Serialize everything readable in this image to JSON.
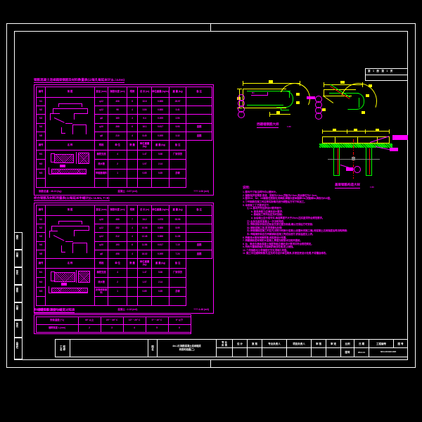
{
  "sheet": {
    "background": "#000000",
    "frame_color": "#ffffff",
    "accent_magenta": "#ff00ff",
    "accent_green": "#00ff00",
    "accent_yellow": "#ffff00",
    "accent_red": "#ff0000",
    "accent_gray": "#808080"
  },
  "header_box": {
    "text": "第 1 册 第 1 页"
  },
  "table1": {
    "title": "钢筋混凝土连续箱梁钢筋及材料数量表(以每孔每延米计)(L=4.0m)",
    "columns": [
      "编号",
      "简  图",
      "直径 (mm)",
      "钢筋长度 (cm)",
      "根数",
      "总  长 (m)",
      "单位重量 (kg/m)",
      "重  量 (kg)",
      "备  注"
    ],
    "rows": [
      {
        "no": "N1",
        "dia": "φ12",
        "len": "408",
        "cnt": "8",
        "total": "32.6",
        "unit": "0.888",
        "weight": "28.97",
        "note": ""
      },
      {
        "no": "N2",
        "dia": "φ12",
        "len": "96",
        "cnt": "4",
        "total": "3.84",
        "unit": "0.888",
        "weight": "3.41",
        "note": ""
      },
      {
        "no": "N3",
        "dia": "φ8",
        "len": "160",
        "cnt": "4",
        "total": "6.4",
        "unit": "0.395",
        "weight": "2.53",
        "note": ""
      },
      {
        "no": "N4",
        "dia": "φ10",
        "len": "268",
        "cnt": "6",
        "total": "16.1",
        "unit": "0.617",
        "weight": "9.93",
        "note": "盘圆"
      },
      {
        "no": "N5",
        "dia": "φ8",
        "len": "210",
        "cnt": "4",
        "total": "8.40",
        "unit": "0.395",
        "weight": "3.32",
        "note": "盘圆"
      }
    ],
    "sub_header": [
      "编号",
      "名  称",
      "规格",
      "单  位",
      "数  量",
      "单位重量 (kg)",
      "重  量 (kg)",
      "备  注"
    ],
    "rows2": [
      {
        "no": "M1",
        "name": "橡胶支座",
        "spec": "",
        "unit": "4",
        "qty": "",
        "each": "1.47",
        "weight": "5.88",
        "note": "厂家供货"
      },
      {
        "no": "M2",
        "name": "泄水管",
        "spec": "",
        "unit": "2",
        "qty": "",
        "each": "1.07",
        "weight": "2.14",
        "note": ""
      },
      {
        "no": "M3",
        "name": "伸缩缝填料",
        "spec": "",
        "unit": "1",
        "qty": "",
        "each": "0.85",
        "weight": "0.85",
        "note": "沥青"
      }
    ],
    "footer": {
      "left": "钢筋总重 : 48.16  (kg)",
      "mid": "混凝土 : 0.57  (m3)",
      "right": "??? 1.68  (m3)"
    }
  },
  "table2": {
    "title": "桥台钢筋及材料用量表(以每延米半幅计)(L=4.0m, T=8)",
    "columns": [
      "编号",
      "简  图",
      "直径 (mm)",
      "钢筋长度 (cm)",
      "根数",
      "总  长 (m)",
      "单位重量 (kg/m)",
      "重  量 (kg)",
      "备  注"
    ],
    "rows": [
      {
        "no": "N1",
        "dia": "φ16",
        "len": "488",
        "cnt": "7",
        "total": "34.2",
        "unit": "1.578",
        "weight": "53.96",
        "note": ""
      },
      {
        "no": "N2",
        "dia": "φ12",
        "len": "252",
        "cnt": "4",
        "total": "10.08",
        "unit": "0.888",
        "weight": "8.95",
        "note": ""
      },
      {
        "no": "N3",
        "dia": "φ12",
        "len": "312",
        "cnt": "4",
        "total": "12.48",
        "unit": "0.888",
        "weight": "11.08",
        "note": ""
      },
      {
        "no": "N4",
        "dia": "φ10",
        "len": "193",
        "cnt": "6",
        "total": "11.58",
        "unit": "0.617",
        "weight": "7.15",
        "note": "盘圆"
      },
      {
        "no": "N5",
        "dia": "φ8",
        "len": "458",
        "cnt": "4",
        "total": "18.32",
        "unit": "0.395",
        "weight": "7.24",
        "note": "盘圆"
      }
    ],
    "sub_header": [
      "编号",
      "名  称",
      "规格",
      "单  位",
      "数  量",
      "单位重量 (kg)",
      "重  量 (kg)",
      "备  注"
    ],
    "rows2": [
      {
        "no": "M1",
        "name": "橡胶支座",
        "spec": "",
        "unit": "4",
        "qty": "",
        "each": "1.47",
        "weight": "5.88",
        "note": "厂家供货"
      },
      {
        "no": "M2",
        "name": "泄水管",
        "spec": "",
        "unit": "2",
        "qty": "",
        "each": "1.07",
        "weight": "2.14",
        "note": ""
      },
      {
        "no": "M3",
        "name": "沥青麻絮填料",
        "spec": "",
        "unit": "1",
        "qty": "",
        "each": "0.85",
        "weight": "0.85",
        "note": "沥青"
      }
    ],
    "footer": {
      "left": "钢筋总重 : 88.38  (kg)",
      "mid": "混凝土 : 2.18  (m3)",
      "right": "??? 4.48  (m3)"
    }
  },
  "table3": {
    "title": "伸缩缝安装温度与缝宽对照表",
    "header": [
      "安装温度 (°C)",
      "30° 以上",
      "20° ~ 30° C",
      "10° ~ 20° C",
      "0° ~ 10° C",
      "0° 以下"
    ],
    "row": [
      "缝隙宽度 L (mm)",
      "2",
      "3",
      "4",
      "5",
      "6"
    ]
  },
  "detail1": {
    "label": "挡碴墙钢筋大样",
    "scale": "1:20"
  },
  "detail2": {
    "label": "",
    "scale": ""
  },
  "detail3": {
    "label": "盖梁钢筋构造大样",
    "scale": "1:20"
  },
  "notes": {
    "title": "说明:",
    "items": [
      {
        "indent": 0,
        "text": "1. 图中尺寸除注明外均以厘米计。"
      },
      {
        "indent": 0,
        "text": "2. 钢筋保护层厚度:梁底、梁侧为3.0cm,顶板为2.5cm,其余部位为2~3cm。"
      },
      {
        "indent": 0,
        "text": "3. 图中N1、N2、N3钢筋在搭接处须焊接,焊缝长度单面焊10d,双面焊5d,焊条为E43型。"
      },
      {
        "indent": 0,
        "text": "4. ①号钢筋在施工时应按实际情况进行调整后方可下料加工。"
      },
      {
        "indent": 0,
        "text": "5. 本桥施工工艺要求如下:"
      },
      {
        "indent": 1,
        "text": "⑴. a. 基坑开挖应按设计要求进行;"
      },
      {
        "indent": 2,
        "text": "b. 基底承载力应满足设计要求;"
      },
      {
        "indent": 2,
        "text": "c. 基础施工完毕后应及时回填;"
      },
      {
        "indent": 2,
        "text": "d. 台后填土应分层夯实,每层厚度不大于20cm,压实度须符合规范要求。"
      },
      {
        "indent": 1,
        "text": "⑵. 台身及盖梁混凝土一次浇筑完成;"
      },
      {
        "indent": 1,
        "text": "⑶. 预制梁板安装前应检查支座位置及标高,确认无误后方可安装;"
      },
      {
        "indent": 1,
        "text": "⑷. 铺装层施工前,梁顶须凿毛处理;"
      },
      {
        "indent": 1,
        "text": "⑸. 桥面铺装层施工时应先浇筑中间部分混凝土(设置纵向施工缝),待混凝土达到强度后再浇筑两侧;"
      },
      {
        "indent": 1,
        "text": "⑹. 伸缩缝安装应在桥面铺装层施工完成后进行,安装温度见上表。"
      },
      {
        "indent": 0,
        "text": "6. 桥面泄水管采用铸铁管,间距按设计布置。"
      },
      {
        "indent": 0,
        "text": "7. 桥面铺装层采用防水混凝土,厚度及配筋详见相关图纸。"
      },
      {
        "indent": 0,
        "text": "8. 台、墩身及基础混凝土强度等级应满足设计要求并符合规范规定。"
      },
      {
        "indent": 0,
        "text": "9. 所有外露钢筋端头须涂刷防锈漆处理,防止锈蚀。"
      },
      {
        "indent": 0,
        "text": "10. ①号钢筋与②号钢筋交叉处须绑扎牢固。"
      },
      {
        "indent": 0,
        "text": "11. 施工中如遇特殊情况,应及时与设计单位联系,并按变更设计处理,不得擅自修改。"
      }
    ]
  },
  "title_block": {
    "project_label": "工 程\n名 称",
    "project_value": "",
    "sheet_label": "图\n名",
    "sheet_title": "4m-1孔钢筋混凝土连续箱梁\n桥梁构造图(二)",
    "roles": [
      {
        "label": "专 业\n负 责",
        "value": ""
      },
      {
        "label": "设  计",
        "value": ""
      },
      {
        "label": "复  核",
        "value": ""
      },
      {
        "label": "专业负责人",
        "value": ""
      },
      {
        "label": "项目负责人",
        "value": ""
      },
      {
        "label": "审  核",
        "value": ""
      },
      {
        "label": "审  定",
        "value": ""
      }
    ],
    "scale_label": "比例",
    "scale_value": "图号",
    "date_label": "日  期",
    "date_value": "2014.10",
    "projno_label": "工程编号",
    "projno_value": "SD11-0401024-0005",
    "dwgno_label": "图  号"
  },
  "side_stamps": {
    "rows": [
      "修改",
      "日期",
      "签名",
      "审核",
      "日期",
      "签名",
      "修改"
    ],
    "bottom": "会签栏"
  }
}
